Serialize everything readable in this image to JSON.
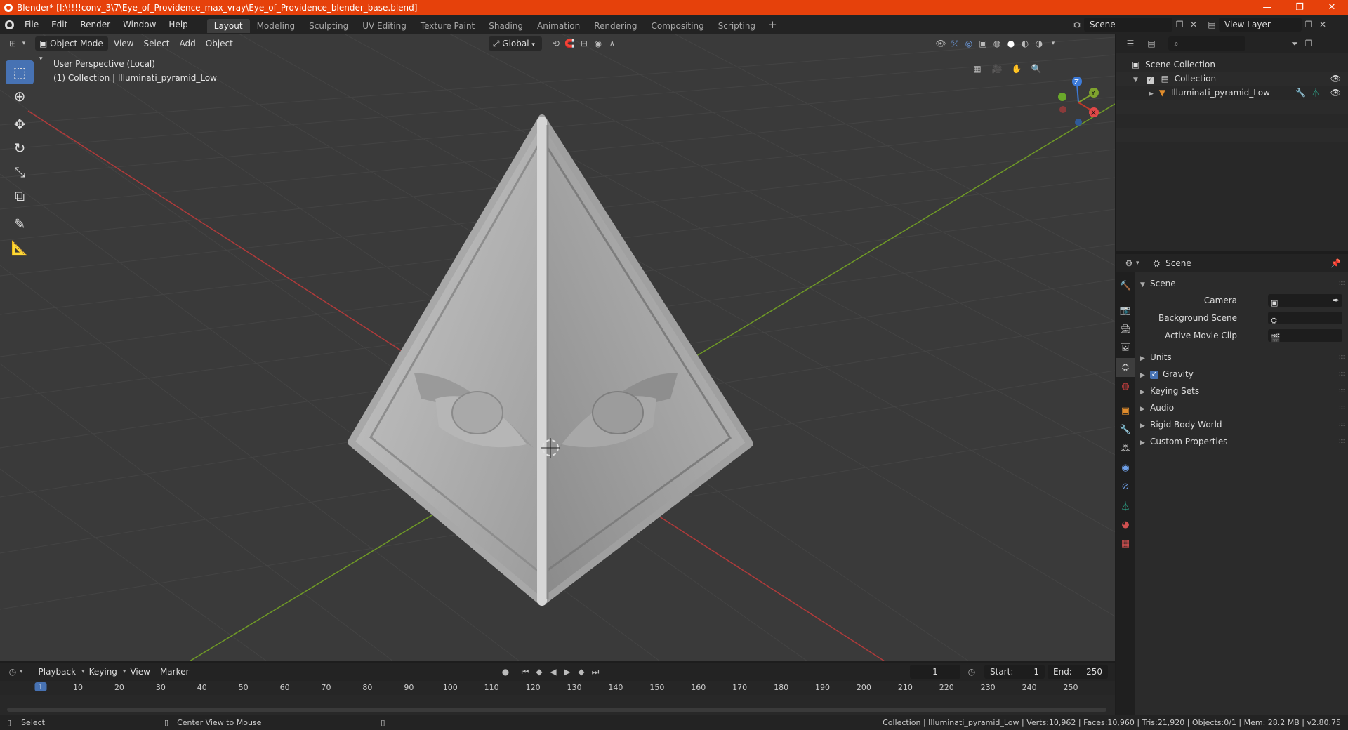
{
  "window": {
    "title": "Blender* [I:\\!!!!conv_3\\7\\Eye_of_Providence_max_vray\\Eye_of_Providence_blender_base.blend]",
    "minimize": "—",
    "maximize": "❐",
    "close": "✕"
  },
  "menu": [
    "File",
    "Edit",
    "Render",
    "Window",
    "Help"
  ],
  "workspaces": [
    "Layout",
    "Modeling",
    "Sculpting",
    "UV Editing",
    "Texture Paint",
    "Shading",
    "Animation",
    "Rendering",
    "Compositing",
    "Scripting"
  ],
  "active_workspace": "Layout",
  "scene_field": "Scene",
  "view_layer_field": "View Layer",
  "viewport": {
    "mode": "Object Mode",
    "menus": [
      "View",
      "Select",
      "Add",
      "Object"
    ],
    "transform_orientation": "Global",
    "perspective_label": "User Perspective (Local)",
    "collection_label": "(1) Collection | Illuminati_pyramid_Low",
    "gizmo": {
      "z": "Z",
      "y": "Y",
      "x": "X"
    }
  },
  "outliner": {
    "scene_collection": "Scene Collection",
    "collection": "Collection",
    "object": "Illuminati_pyramid_Low"
  },
  "properties": {
    "header": "Scene",
    "panel": "Scene",
    "camera_label": "Camera",
    "background_scene_label": "Background Scene",
    "active_movie_clip_label": "Active Movie Clip",
    "sections": [
      "Units",
      "Gravity",
      "Keying Sets",
      "Audio",
      "Rigid Body World",
      "Custom Properties"
    ]
  },
  "timeline": {
    "menus": [
      "Playback",
      "Keying",
      "View",
      "Marker"
    ],
    "current_frame": "1",
    "start_label": "Start:",
    "start": "1",
    "end_label": "End:",
    "end": "250",
    "ruler": [
      "1",
      "10",
      "20",
      "30",
      "40",
      "50",
      "60",
      "70",
      "80",
      "90",
      "100",
      "110",
      "120",
      "130",
      "140",
      "150",
      "160",
      "170",
      "180",
      "190",
      "200",
      "210",
      "220",
      "230",
      "240",
      "250"
    ]
  },
  "status": {
    "select": "Select",
    "center_view": "Center View to Mouse",
    "stats": "Collection | Illuminati_pyramid_Low | Verts:10,962 | Faces:10,960 | Tris:21,920 | Objects:0/1 | Mem: 28.2 MB | v2.80.75"
  },
  "colors": {
    "title_bar": "#e6410b",
    "accent": "#4772b3",
    "viewport_bg": "#3a3a3a",
    "x_axis": "#c0392b",
    "y_axis": "#7fa32e"
  }
}
